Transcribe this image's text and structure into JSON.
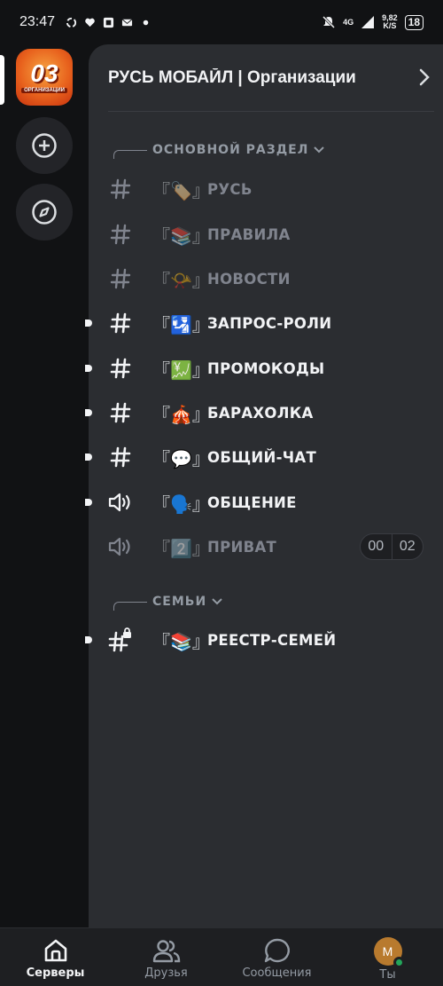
{
  "status_bar": {
    "time": "23:47",
    "network": "4G",
    "speed_value": "9,82",
    "speed_unit": "K/S",
    "battery": "18"
  },
  "server": {
    "icon_text": "03",
    "icon_subtext": "ОРГАНИЗАЦИИ",
    "name": "РУСЬ МОБАЙЛ | Организации"
  },
  "categories": [
    {
      "label": "ОСНОВНОЙ РАЗДЕЛ"
    },
    {
      "label": "СЕМЬИ"
    }
  ],
  "channels": [
    {
      "emoji": "『🏷️』",
      "name": "РУСЬ",
      "type": "text"
    },
    {
      "emoji": "『📚』",
      "name": "ПРАВИЛА",
      "type": "text"
    },
    {
      "emoji": "『📯』",
      "name": "НОВОСТИ",
      "type": "text"
    },
    {
      "emoji": "『🛂』",
      "name": "ЗАПРОС-РОЛИ",
      "type": "text"
    },
    {
      "emoji": "『💹』",
      "name": "ПРОМОКОДЫ",
      "type": "text"
    },
    {
      "emoji": "『🎪』",
      "name": "БАРАХОЛКА",
      "type": "text"
    },
    {
      "emoji": "『💬』",
      "name": "ОБЩИЙ-ЧАТ",
      "type": "text"
    },
    {
      "emoji": "『🗣️』",
      "name": "ОБЩЕНИЕ",
      "type": "voice"
    },
    {
      "emoji": "『2️⃣』",
      "name": "ПРИВАТ",
      "type": "voice",
      "users": "00",
      "limit": "02"
    },
    {
      "emoji": "『📚』",
      "name": "РЕЕСТР-СЕМЕЙ",
      "type": "text-locked"
    }
  ],
  "nav": {
    "servers": "Серверы",
    "friends": "Друзья",
    "messages": "Сообщения",
    "you": "Ты",
    "avatar_letter": "M"
  },
  "colors": {
    "background": "#111214",
    "panel": "#2b2d31",
    "muted_text": "#80848e",
    "active_text": "#f2f3f5",
    "online": "#23a55a"
  }
}
